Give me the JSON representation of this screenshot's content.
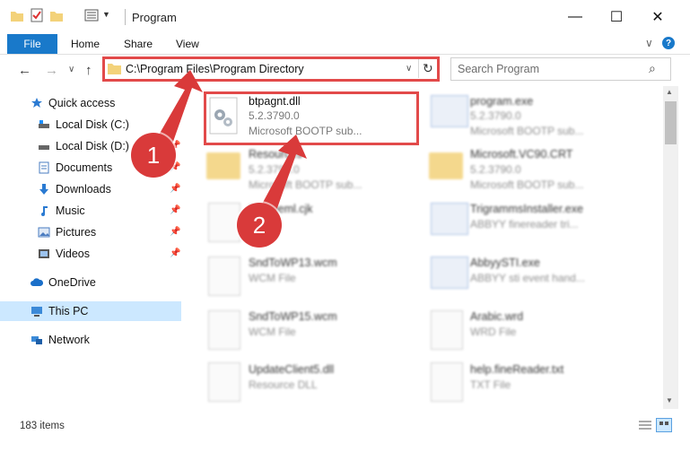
{
  "window": {
    "title": "Program",
    "minimize": "—",
    "maximize": "☐",
    "close": "✕"
  },
  "ribbon": {
    "file": "File",
    "tabs": [
      "Home",
      "Share",
      "View"
    ],
    "help": "?",
    "expand": "∨"
  },
  "nav": {
    "back": "←",
    "forward": "→",
    "recent": "∨",
    "up": "↑",
    "address": "C:\\Program Files\\Program Directory",
    "dropdown": "∨",
    "refresh": "↻",
    "search_placeholder": "Search Program",
    "search_icon": "⌕"
  },
  "sidebar": {
    "items": [
      {
        "label": "Quick access",
        "icon": "star-icon",
        "pinned": false
      },
      {
        "label": "Local Disk (C:)",
        "icon": "drive-icon",
        "pinned": true
      },
      {
        "label": "Local Disk (D:)",
        "icon": "drive-icon",
        "pinned": true
      },
      {
        "label": "Documents",
        "icon": "documents-icon",
        "pinned": true
      },
      {
        "label": "Downloads",
        "icon": "download-icon",
        "pinned": true
      },
      {
        "label": "Music",
        "icon": "music-icon",
        "pinned": true
      },
      {
        "label": "Pictures",
        "icon": "pictures-icon",
        "pinned": true
      },
      {
        "label": "Videos",
        "icon": "videos-icon",
        "pinned": true
      },
      {
        "label": "OneDrive",
        "icon": "cloud-icon",
        "pinned": false
      },
      {
        "label": "This PC",
        "icon": "computer-icon",
        "pinned": false,
        "selected": true
      },
      {
        "label": "Network",
        "icon": "network-icon",
        "pinned": false
      }
    ]
  },
  "files": [
    {
      "name": "btpagnt.dll",
      "line2": "5.2.3790.0",
      "line3": "Microsoft BOOTP sub...",
      "kind": "dll"
    },
    {
      "name": "program.exe",
      "line2": "5.2.3790.0",
      "line3": "Microsoft BOOTP sub...",
      "kind": "app"
    },
    {
      "name": "Resources",
      "line2": "5.2.3790.0",
      "line3": "Microsoft BOOTP sub...",
      "kind": "folder"
    },
    {
      "name": "Microsoft.VC90.CRT",
      "line2": "5.2.3790.0",
      "line3": "Microsoft BOOTP sub...",
      "kind": "folder"
    },
    {
      "name": "Enumeml.cjk",
      "line2": "",
      "line3": "",
      "kind": "doc"
    },
    {
      "name": "TrigrammsInstaller.exe",
      "line2": "ABBYY finereader tri...",
      "line3": "",
      "kind": "app"
    },
    {
      "name": "SndToWP13.wcm",
      "line2": "WCM File",
      "line3": "",
      "kind": "doc"
    },
    {
      "name": "AbbyySTI.exe",
      "line2": "ABBYY sti event hand...",
      "line3": "",
      "kind": "app"
    },
    {
      "name": "SndToWP15.wcm",
      "line2": "WCM File",
      "line3": "",
      "kind": "doc"
    },
    {
      "name": "Arabic.wrd",
      "line2": "WRD File",
      "line3": "",
      "kind": "doc"
    },
    {
      "name": "UpdateClient5.dll",
      "line2": "Resource DLL",
      "line3": "",
      "kind": "dll"
    },
    {
      "name": "help.fineReader.txt",
      "line2": "TXT File",
      "line3": "",
      "kind": "doc"
    }
  ],
  "callouts": [
    {
      "number": "1"
    },
    {
      "number": "2"
    }
  ],
  "status": {
    "items": "183 items"
  },
  "colors": {
    "accent": "#1979ca",
    "highlight": "#e24a4a",
    "callout": "#d93a3a",
    "selected": "#cce8ff"
  }
}
